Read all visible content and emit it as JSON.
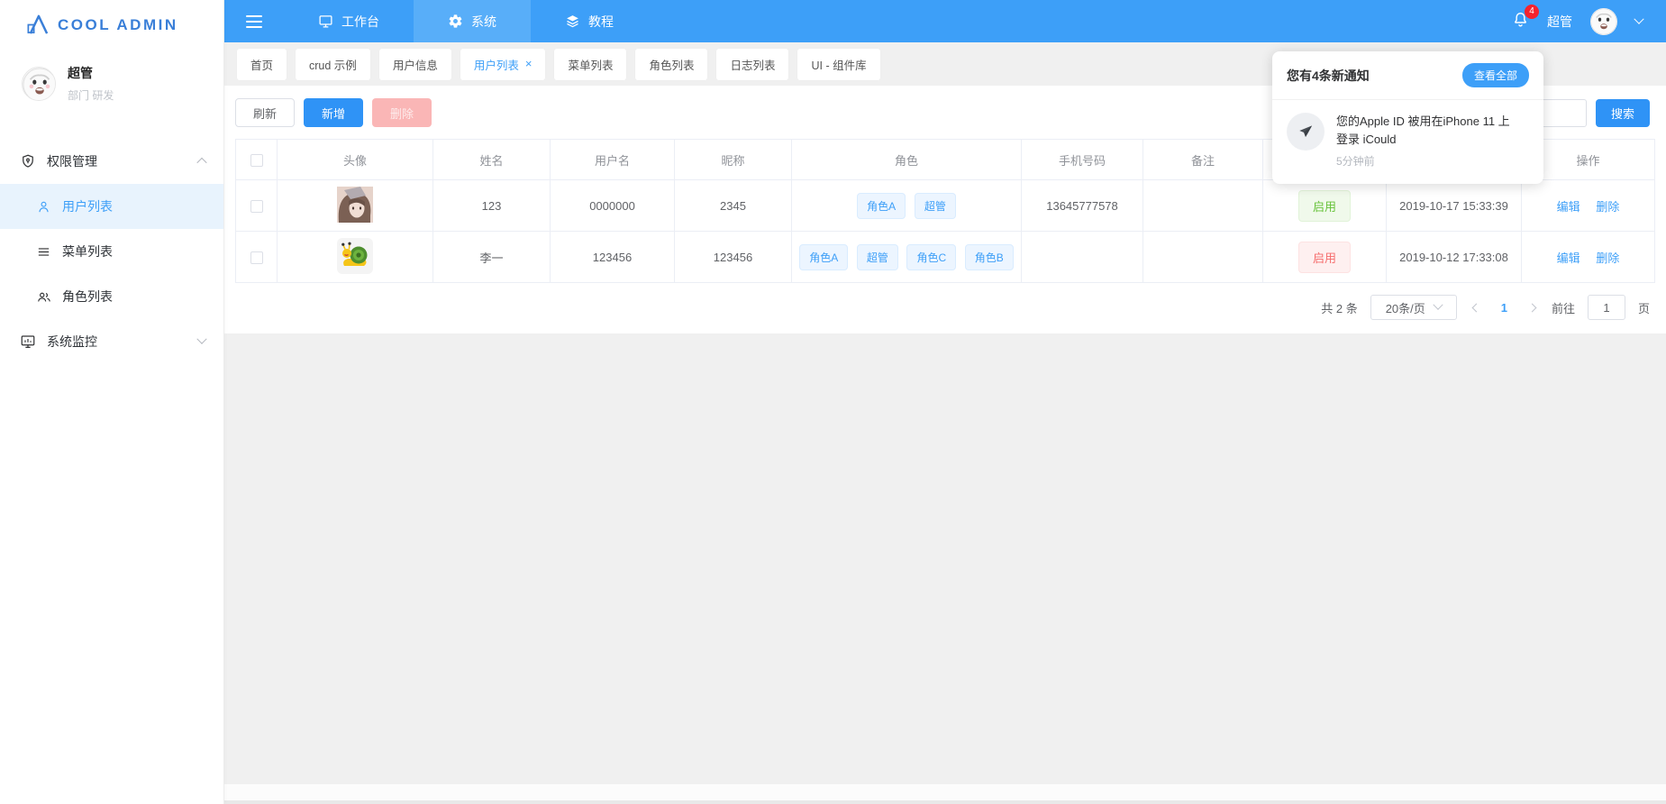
{
  "brand": {
    "name": "COOL ADMIN"
  },
  "colors": {
    "accent": "#3d9ff8",
    "topbar": "#3d9ff8",
    "badge_red": "#f5222d",
    "success": "#67c23a",
    "danger": "#f56c6c",
    "chip_blue": "#ecf5ff"
  },
  "topbar": {
    "nav": [
      {
        "label": "工作台"
      },
      {
        "label": "系统"
      },
      {
        "label": "教程"
      }
    ],
    "badge_count": "4",
    "username": "超管"
  },
  "sidebar": {
    "user": {
      "name": "超管",
      "dept": "部门 研发"
    },
    "sections": [
      {
        "label": "权限管理",
        "expanded": true,
        "items": [
          {
            "label": "用户列表",
            "active": true
          },
          {
            "label": "菜单列表"
          },
          {
            "label": "角色列表"
          }
        ]
      },
      {
        "label": "系统监控",
        "expanded": false,
        "items": []
      }
    ]
  },
  "tabs": {
    "close_glyph": "×",
    "items": [
      {
        "label": "首页"
      },
      {
        "label": "crud 示例"
      },
      {
        "label": "用户信息"
      },
      {
        "label": "用户列表",
        "active": true,
        "closable": true
      },
      {
        "label": "菜单列表"
      },
      {
        "label": "角色列表"
      },
      {
        "label": "日志列表"
      },
      {
        "label": "UI - 组件库"
      }
    ]
  },
  "toolbar": {
    "refresh_label": "刷新",
    "add_label": "新增",
    "delete_label": "删除",
    "search_label": "搜索",
    "search_value": ""
  },
  "table": {
    "headers": {
      "avatar": "头像",
      "name": "姓名",
      "username": "用户名",
      "nickname": "昵称",
      "roles": "角色",
      "phone": "手机号码",
      "remark": "备注",
      "status": "",
      "created": "",
      "actions": "操作"
    },
    "actions_labels": {
      "edit": "编辑",
      "delete": "删除"
    },
    "rows": [
      {
        "avatar": "girl-photo",
        "name": "123",
        "username": "0000000",
        "nickname": "2345",
        "roles": [
          "角色A",
          "超管"
        ],
        "phone": "13645777578",
        "remark": "",
        "status": "启用",
        "status_color": "green",
        "created": "2019-10-17 15:33:39"
      },
      {
        "avatar": "snail-cartoon",
        "name": "李一",
        "username": "123456",
        "nickname": "123456",
        "roles": [
          "角色A",
          "超管",
          "角色C",
          "角色B"
        ],
        "phone": "",
        "remark": "",
        "status": "启用",
        "status_color": "red",
        "created": "2019-10-12 17:33:08"
      }
    ]
  },
  "pagination": {
    "total": "共 2 条",
    "page_size": "20条/页",
    "current_page": "1",
    "goto_label": "前往",
    "goto_value": "1",
    "unit_label": "页"
  },
  "notification": {
    "title": "您有4条新通知",
    "view_all_label": "查看全部",
    "items": [
      {
        "text": "您的Apple ID 被用在iPhone 11 上登录 iCould",
        "time": "5分钟前"
      }
    ]
  }
}
